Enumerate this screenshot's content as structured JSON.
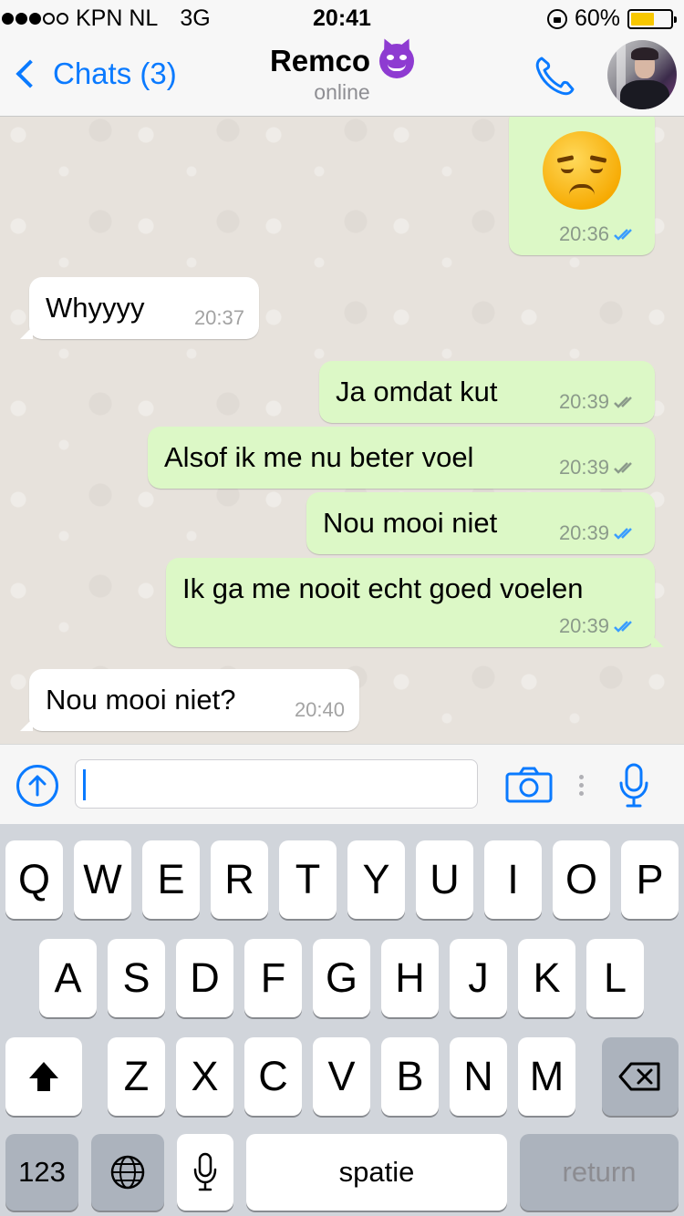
{
  "status_bar": {
    "carrier": "KPN NL",
    "network": "3G",
    "time": "20:41",
    "battery": "60%",
    "battery_level": 0.6
  },
  "header": {
    "back_label": "Chats (3)",
    "contact_name": "Remco",
    "contact_status": "online"
  },
  "messages": [
    {
      "direction": "out",
      "type": "emoji",
      "emoji": "sad-face-emoji",
      "time": "20:36",
      "status": "read"
    },
    {
      "direction": "in",
      "text": "Whyyyy",
      "time": "20:37"
    },
    {
      "direction": "out",
      "text": "Ja omdat kut",
      "time": "20:39",
      "status": "delivered"
    },
    {
      "direction": "out",
      "text": "Alsof ik me nu beter voel",
      "time": "20:39",
      "status": "delivered"
    },
    {
      "direction": "out",
      "text": "Nou mooi niet",
      "time": "20:39",
      "status": "read"
    },
    {
      "direction": "out",
      "text": "Ik ga me nooit echt goed voelen",
      "time": "20:39",
      "status": "read"
    },
    {
      "direction": "in",
      "text": "Nou mooi niet?",
      "time": "20:40"
    }
  ],
  "input": {
    "value": ""
  },
  "keyboard": {
    "row1": [
      "Q",
      "W",
      "E",
      "R",
      "T",
      "Y",
      "U",
      "I",
      "O",
      "P"
    ],
    "row2": [
      "A",
      "S",
      "D",
      "F",
      "G",
      "H",
      "J",
      "K",
      "L"
    ],
    "row3": [
      "Z",
      "X",
      "C",
      "V",
      "B",
      "N",
      "M"
    ],
    "numbers_label": "123",
    "space_label": "spatie",
    "return_label": "return"
  },
  "colors": {
    "accent": "#0a7aff",
    "outgoing_bubble": "#dcf8c6",
    "incoming_bubble": "#ffffff",
    "read_ticks": "#3a9dff",
    "delivered_ticks": "#8b9a8a"
  }
}
